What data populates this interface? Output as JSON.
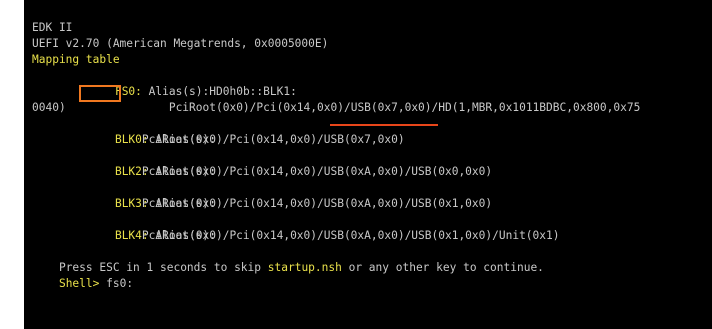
{
  "console": {
    "header_line1": "EDK II",
    "header_line2": "UEFI v2.70 (American Megatrends, 0x0005000E)",
    "mapping_title": "Mapping table",
    "fs0": {
      "name": "FS0:",
      "alias": " Alias(s):HD0h0b::BLK1:",
      "path_prefix": "        PciRoot(0x0)/Pci(0x14,0x0)",
      "path_usb": "/USB(0x7,0x0)",
      "path_suffix": "/HD(1,MBR,0x1011BDBC,0x800,0x75",
      "path_wrap": "0040)"
    },
    "blk0": {
      "name": "BLK0:",
      "alias": " Alias(s):",
      "path": "        PciRoot(0x0)/Pci(0x14,0x0)/USB(0x7,0x0)"
    },
    "blk2": {
      "name": "BLK2:",
      "alias": " Alias(s):",
      "path": "        PciRoot(0x0)/Pci(0x14,0x0)/USB(0xA,0x0)/USB(0x0,0x0)"
    },
    "blk3": {
      "name": "BLK3:",
      "alias": " Alias(s):",
      "path": "        PciRoot(0x0)/Pci(0x14,0x0)/USB(0xA,0x0)/USB(0x1,0x0)"
    },
    "blk4": {
      "name": "BLK4:",
      "alias": " Alias(s):",
      "path": "        PciRoot(0x0)/Pci(0x14,0x0)/USB(0xA,0x0)/USB(0x1,0x0)/Unit(0x1)"
    },
    "press_esc": {
      "before": "Press ESC in 1 seconds to skip ",
      "startup_file": "startup.nsh",
      "after": " or any other key to continue."
    },
    "prompt": {
      "label": "Shell>",
      "command": " fs0:"
    }
  },
  "colors": {
    "background": "#000000",
    "text": "#c8c8c8",
    "highlight_yellow": "#e8e04a",
    "annotation_box": "#f07820",
    "annotation_underline": "#e8461a"
  }
}
